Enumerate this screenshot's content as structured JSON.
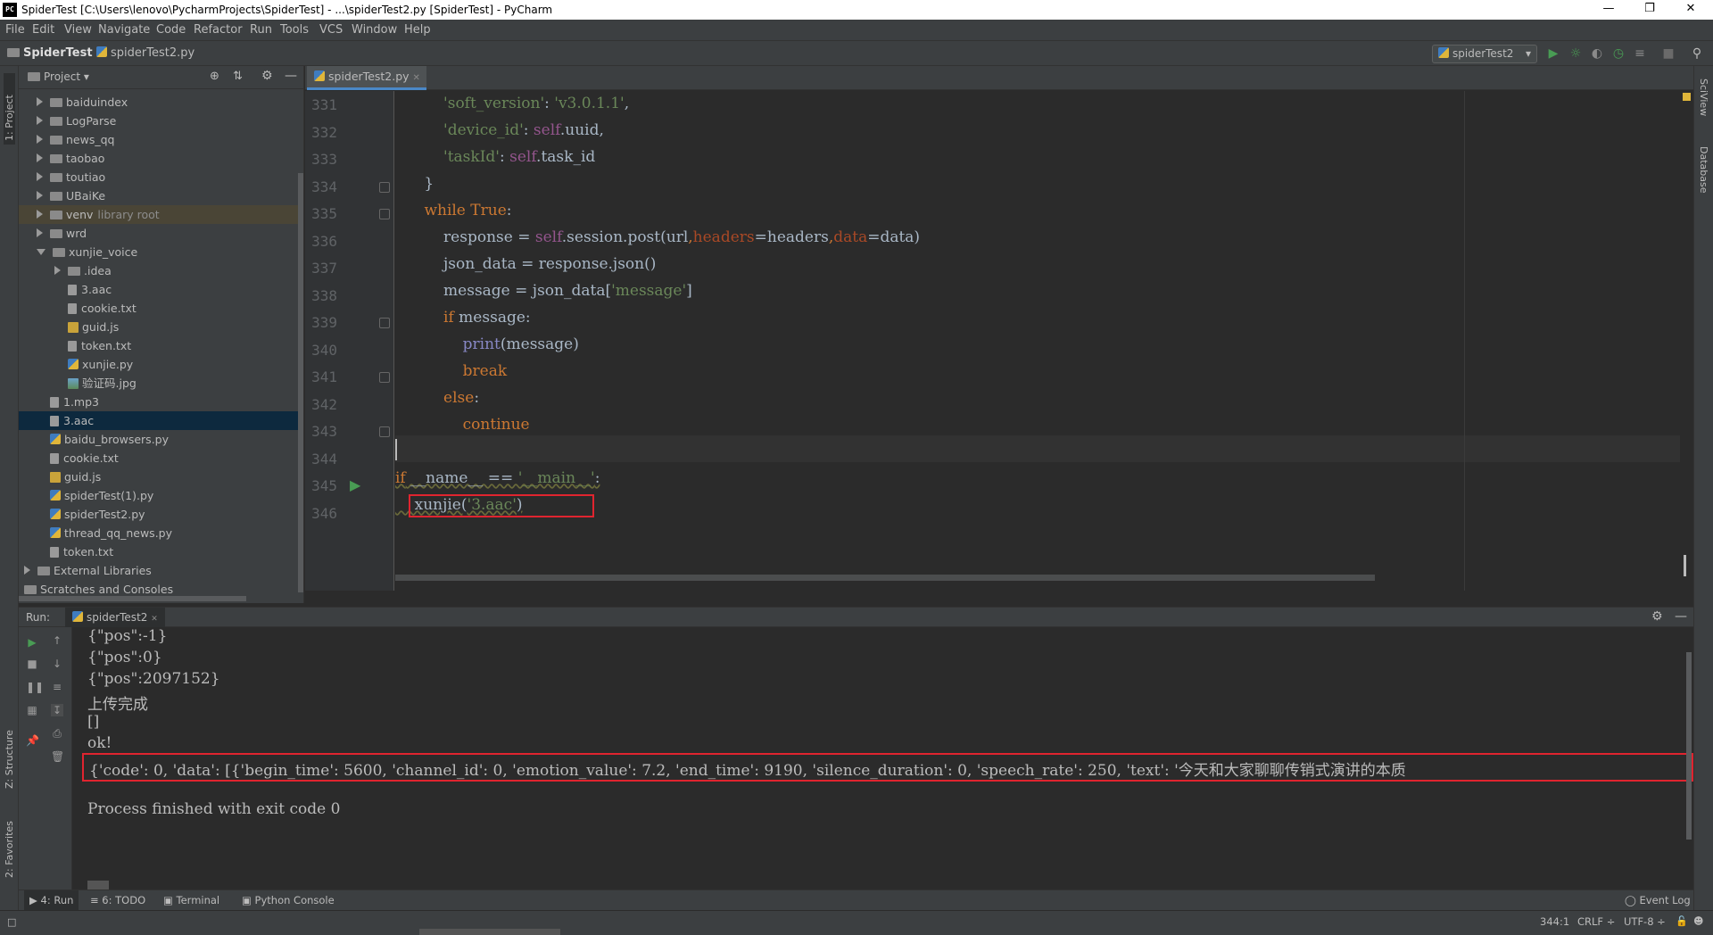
{
  "window": {
    "title": "SpiderTest [C:\\Users\\lenovo\\PycharmProjects\\SpiderTest] - ...\\spiderTest2.py [SpiderTest] - PyCharm",
    "app_icon": "PC"
  },
  "menu": [
    "File",
    "Edit",
    "View",
    "Navigate",
    "Code",
    "Refactor",
    "Run",
    "Tools",
    "VCS",
    "Window",
    "Help"
  ],
  "navbar": {
    "project": "SpiderTest",
    "file": "spiderTest2.py",
    "run_config": "spiderTest2"
  },
  "left_stripe": {
    "project_tab": "1: Project",
    "structure_tab": "Z: Structure",
    "favorites_tab": "2: Favorites"
  },
  "right_stripe": {
    "sciview_tab": "SciView",
    "database_tab": "Database"
  },
  "project_panel": {
    "title": "Project",
    "tree": [
      {
        "label": "baiduindex",
        "type": "folder"
      },
      {
        "label": "LogParse",
        "type": "folder"
      },
      {
        "label": "news_qq",
        "type": "folder"
      },
      {
        "label": "taobao",
        "type": "folder"
      },
      {
        "label": "toutiao",
        "type": "folder"
      },
      {
        "label": "UBaiKe",
        "type": "folder"
      },
      {
        "label": "venv",
        "suffix": "library root",
        "type": "folder"
      },
      {
        "label": "wrd",
        "type": "folder"
      },
      {
        "label": "xunjie_voice",
        "type": "folder-open"
      },
      {
        "label": ".idea",
        "type": "folder"
      },
      {
        "label": "3.aac",
        "type": "file"
      },
      {
        "label": "cookie.txt",
        "type": "file"
      },
      {
        "label": "guid.js",
        "type": "js"
      },
      {
        "label": "token.txt",
        "type": "file"
      },
      {
        "label": "xunjie.py",
        "type": "py"
      },
      {
        "label": "验证码.jpg",
        "type": "img"
      },
      {
        "label": "1.mp3",
        "type": "file"
      },
      {
        "label": "3.aac",
        "type": "file"
      },
      {
        "label": "baidu_browsers.py",
        "type": "py"
      },
      {
        "label": "cookie.txt",
        "type": "file"
      },
      {
        "label": "guid.js",
        "type": "js"
      },
      {
        "label": "spiderTest(1).py",
        "type": "py"
      },
      {
        "label": "spiderTest2.py",
        "type": "py"
      },
      {
        "label": "thread_qq_news.py",
        "type": "py"
      },
      {
        "label": "token.txt",
        "type": "file"
      },
      {
        "label": "External Libraries",
        "type": "lib"
      },
      {
        "label": "Scratches and Consoles",
        "type": "scratch"
      }
    ]
  },
  "editor": {
    "tab": "spiderTest2.py",
    "line_numbers": [
      "331",
      "332",
      "333",
      "334",
      "335",
      "336",
      "337",
      "338",
      "339",
      "340",
      "341",
      "342",
      "343",
      "344",
      "345",
      "346"
    ]
  },
  "run_panel": {
    "label": "Run:",
    "tab": "spiderTest2",
    "output": [
      "{\"pos\":-1}",
      "{\"pos\":0}",
      "{\"pos\":2097152}",
      "上传完成",
      "[]",
      "ok!",
      "{'code': 0, 'data': [{'begin_time': 5600, 'channel_id': 0, 'emotion_value': 7.2, 'end_time': 9190, 'silence_duration': 0, 'speech_rate': 250, 'text': '今天和大家聊聊传销式演讲的本质",
      "",
      "Process finished with exit code 0"
    ]
  },
  "tool_tabs": [
    "4: Run",
    "6: TODO",
    "Terminal",
    "Python Console"
  ],
  "event_log": "Event Log",
  "status": {
    "position": "344:1",
    "line_sep": "CRLF ÷",
    "encoding": "UTF-8 ÷"
  }
}
